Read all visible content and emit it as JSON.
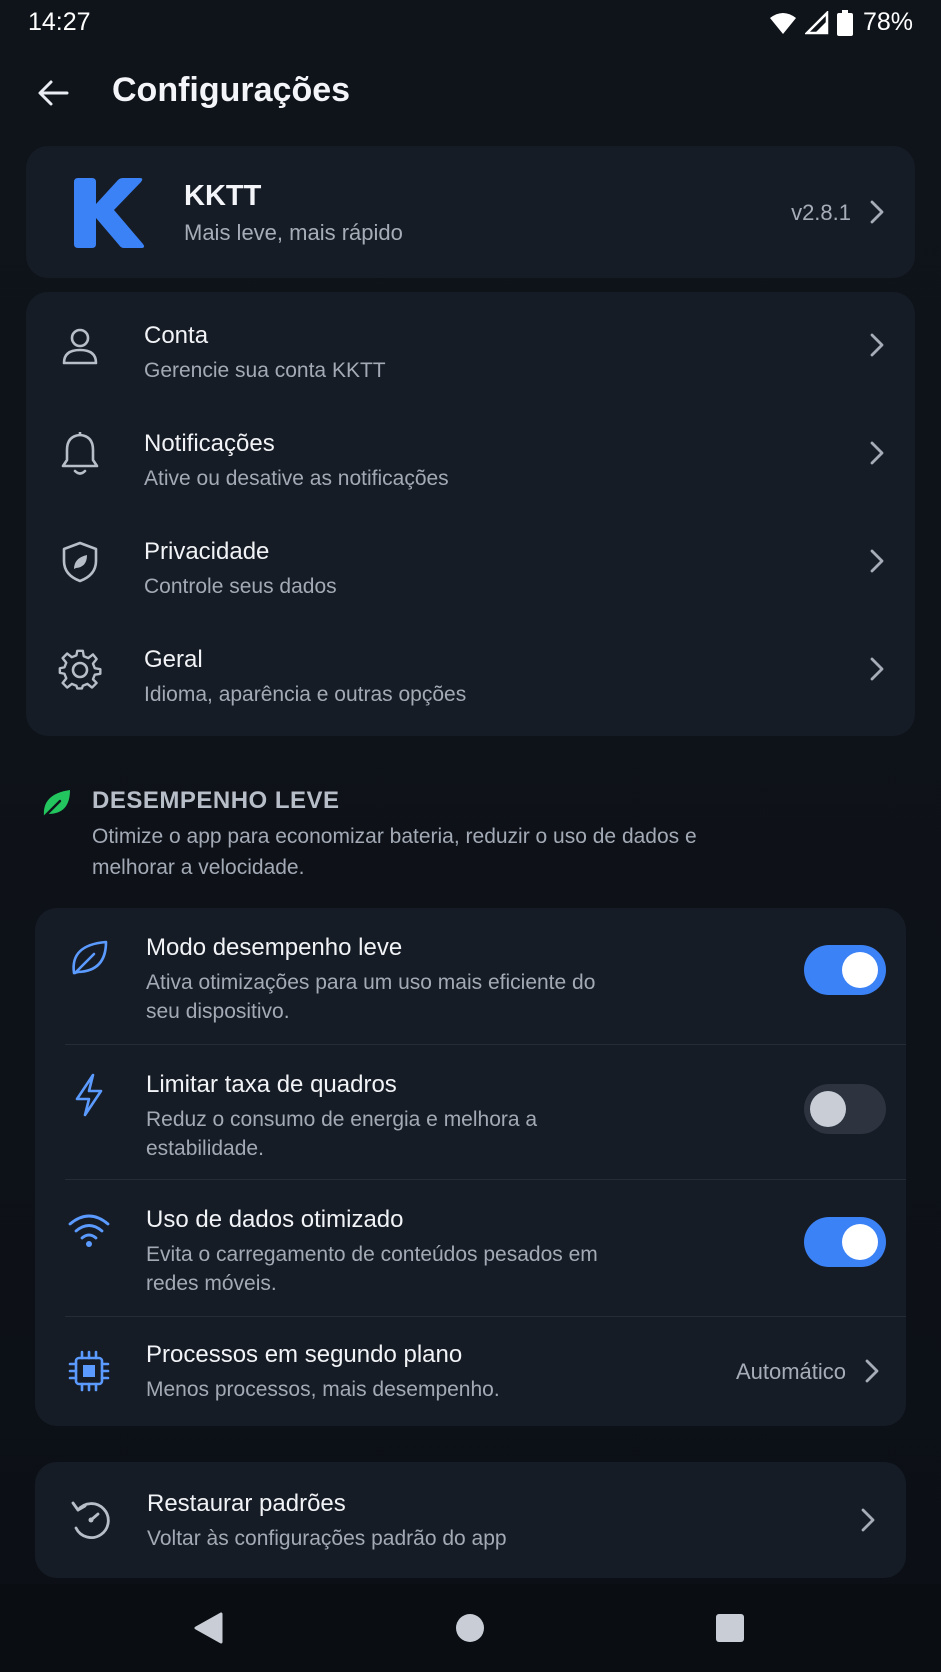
{
  "status_bar": {
    "time": "14:27",
    "battery": "78%"
  },
  "app_bar": {
    "title": "Configurações"
  },
  "app_card": {
    "name": "KKTT",
    "tagline": "Mais leve, mais rápido",
    "version": "v2.8.1"
  },
  "settings": {
    "items": [
      {
        "title": "Conta",
        "subtitle": "Gerencie sua conta KKTT",
        "icon": "user-icon"
      },
      {
        "title": "Notificações",
        "subtitle": "Ative ou desative as notificações",
        "icon": "bell-icon"
      },
      {
        "title": "Privacidade",
        "subtitle": "Controle seus dados",
        "icon": "shield-icon"
      },
      {
        "title": "Geral",
        "subtitle": "Idioma, aparência e outras opções",
        "icon": "gear-icon"
      }
    ]
  },
  "performance": {
    "title": "DESEMPENHO LEVE",
    "description": "Otimize o app para economizar bateria, reduzir o uso de dados e melhorar a velocidade.",
    "items": [
      {
        "title": "Modo desempenho leve",
        "subtitle": "Ativa otimizações para um uso mais eficiente do seu dispositivo.",
        "enabled": true,
        "icon": "leaf-icon"
      },
      {
        "title": "Limitar taxa de quadros",
        "subtitle": "Reduz o consumo de energia e melhora a estabilidade.",
        "enabled": false,
        "icon": "lightning-icon"
      },
      {
        "title": "Uso de dados otimizado",
        "subtitle": "Evita o carregamento de conteúdos pesados em redes móveis.",
        "enabled": true,
        "icon": "wifi-icon"
      }
    ],
    "background": {
      "title": "Processos em segundo plano",
      "subtitle": "Menos processos, mais desempenho.",
      "value": "Automático",
      "icon": "chip-icon"
    }
  },
  "restore": {
    "title": "Restaurar padrões",
    "subtitle": "Voltar às configurações padrão do app",
    "icon": "restore-icon"
  },
  "colors": {
    "accent": "#3b82f6",
    "leaf": "#22c55e",
    "card": "#161c25",
    "background": "#0d1117"
  }
}
